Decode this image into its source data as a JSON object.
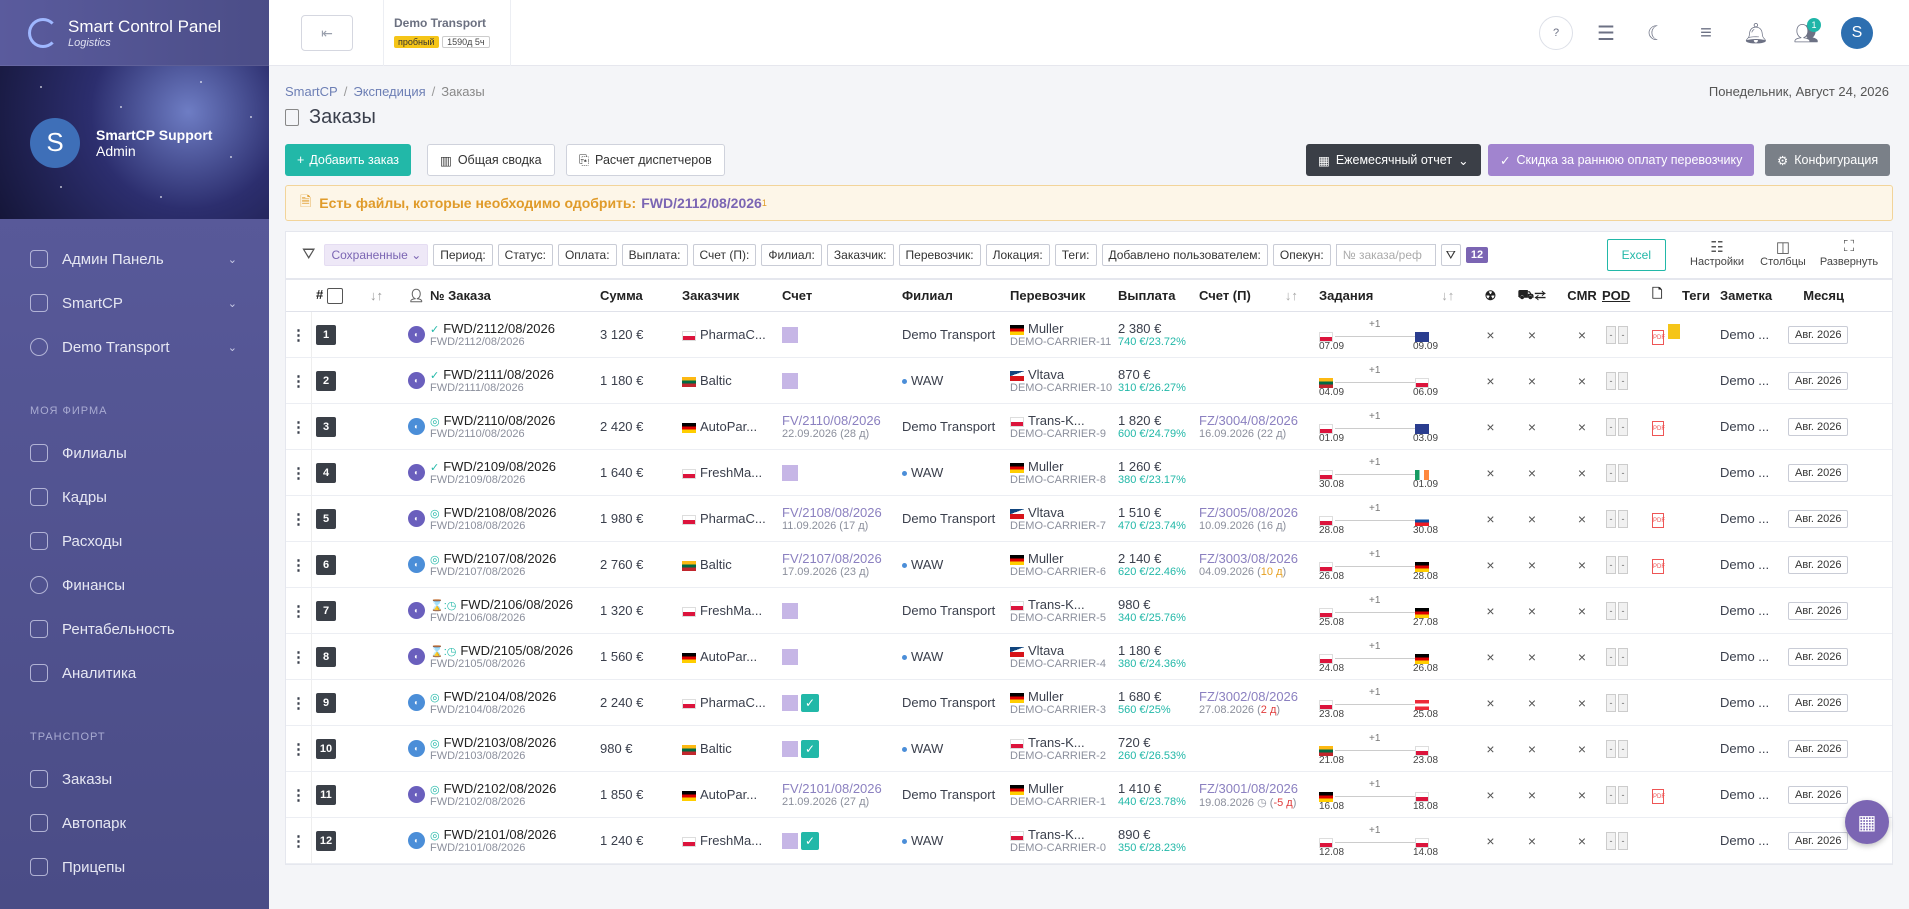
{
  "app": {
    "title": "Smart Control Panel",
    "subtitle": "Logistics"
  },
  "profile": {
    "name": "SmartCP Support",
    "role": "Admin",
    "initial": "S"
  },
  "sidebar": {
    "top": [
      {
        "label": "Админ Панель"
      },
      {
        "label": "SmartCP"
      },
      {
        "label": "Demo Transport"
      }
    ],
    "section1": "МОЯ ФИРМА",
    "firm": [
      {
        "label": "Филиалы"
      },
      {
        "label": "Кадры"
      },
      {
        "label": "Расходы"
      },
      {
        "label": "Финансы"
      },
      {
        "label": "Рентабельность"
      },
      {
        "label": "Аналитика"
      }
    ],
    "section2": "ТРАНСПОРТ",
    "transport": [
      {
        "label": "Заказы"
      },
      {
        "label": "Автопарк"
      },
      {
        "label": "Прицепы"
      }
    ]
  },
  "topbar": {
    "org_name": "Demo Transport",
    "badge_trial": "пробный",
    "badge_time": "1590д 5ч",
    "help": "?",
    "notif_count": "1",
    "user_initial": "S"
  },
  "breadcrumb": {
    "root": "SmartCP",
    "mid": "Экспедиция",
    "current": "Заказы"
  },
  "date": "Понедельник, Август 24, 2026",
  "page_title": "Заказы",
  "actions": {
    "add": "Добавить заказ",
    "summary": "Общая сводка",
    "dispatch": "Расчет диспетчеров",
    "monthly": "Ежемесячный отчет",
    "discount": "Скидка за раннюю оплату перевозчику",
    "config": "Конфигурация"
  },
  "alert": {
    "text": "Есть файлы, которые необходимо одобрить:",
    "link": "FWD/2112/08/2026",
    "sup": "1"
  },
  "filters": {
    "saved": "Сохраненные",
    "chips": [
      "Период:",
      "Статус:",
      "Оплата:",
      "Выплата:",
      "Счет (П):",
      "Филиал:",
      "Заказчик:",
      "Перевозчик:",
      "Локация:",
      "Теги:",
      "Добавлено пользователем:",
      "Опекун:"
    ],
    "search_placeholder": "№ заказа/реф",
    "count": "12",
    "excel": "Excel",
    "tools": [
      "Настройки",
      "Столбцы",
      "Развернуть"
    ]
  },
  "columns": {
    "num": "#",
    "order": "№ Заказа",
    "sum": "Сумма",
    "customer": "Заказчик",
    "invoice": "Счет",
    "branch": "Филиал",
    "carrier": "Перевозчик",
    "payout": "Выплата",
    "inv_p": "Счет (П)",
    "tasks": "Задания",
    "cmr": "CMR",
    "pod": "POD",
    "tags": "Теги",
    "note": "Заметка",
    "month": "Месяц"
  },
  "rows": [
    {
      "n": "1",
      "status": "✓",
      "order": "FWD/2112/08/2026",
      "sub": "FWD/2112/08/2026",
      "sum": "3 120 €",
      "cust_flag": "pl",
      "cust": "PharmaC...",
      "inv": "",
      "inv_date": "",
      "inv_sq": true,
      "inv_chk": false,
      "branch": "Demo Transport",
      "branch_dot": false,
      "car_flag": "de",
      "carrier": "Muller",
      "car_sub": "DEMO-CARRIER-11",
      "pay": "2 380 €",
      "pay_sub": "740 €/23.72%",
      "ip": "",
      "ip_date": "",
      "ip_extra": "",
      "t_from": "pl",
      "d_from": "07.09",
      "t_to": "gb",
      "d_to": "09.09",
      "pdf": true,
      "file": true,
      "note": "Demo ...",
      "month": "Авг. 2026",
      "circ": "a"
    },
    {
      "n": "2",
      "status": "✓",
      "order": "FWD/2111/08/2026",
      "sub": "FWD/2111/08/2026",
      "sum": "1 180 €",
      "cust_flag": "lt",
      "cust": "Baltic",
      "inv": "",
      "inv_date": "",
      "inv_sq": true,
      "inv_chk": false,
      "branch": "WAW",
      "branch_dot": true,
      "car_flag": "cz",
      "carrier": "Vltava",
      "car_sub": "DEMO-CARRIER-10",
      "pay": "870 €",
      "pay_sub": "310 €/26.27%",
      "ip": "",
      "ip_date": "",
      "ip_extra": "",
      "t_from": "lt",
      "d_from": "04.09",
      "t_to": "pl",
      "d_to": "06.09",
      "pdf": false,
      "file": false,
      "note": "Demo ...",
      "month": "Авг. 2026",
      "circ": "a"
    },
    {
      "n": "3",
      "status": "◎",
      "order": "FWD/2110/08/2026",
      "sub": "FWD/2110/08/2026",
      "sum": "2 420 €",
      "cust_flag": "de",
      "cust": "AutoPar...",
      "inv": "FV/2110/08/2026",
      "inv_date": "22.09.2026 (28 д)",
      "inv_sq": false,
      "inv_chk": false,
      "branch": "Demo Transport",
      "branch_dot": false,
      "car_flag": "pl",
      "carrier": "Trans-K...",
      "car_sub": "DEMO-CARRIER-9",
      "pay": "1 820 €",
      "pay_sub": "600 €/24.79%",
      "ip": "FZ/3004/08/2026",
      "ip_date": "16.09.2026 (22 д)",
      "ip_extra": "",
      "t_from": "pl",
      "d_from": "01.09",
      "t_to": "gb",
      "d_to": "03.09",
      "pdf": true,
      "file": false,
      "note": "Demo ...",
      "month": "Авг. 2026",
      "circ": "b"
    },
    {
      "n": "4",
      "status": "✓",
      "order": "FWD/2109/08/2026",
      "sub": "FWD/2109/08/2026",
      "sum": "1 640 €",
      "cust_flag": "pl",
      "cust": "FreshMa...",
      "inv": "",
      "inv_date": "",
      "inv_sq": true,
      "inv_chk": false,
      "branch": "WAW",
      "branch_dot": true,
      "car_flag": "de",
      "carrier": "Muller",
      "car_sub": "DEMO-CARRIER-8",
      "pay": "1 260 €",
      "pay_sub": "380 €/23.17%",
      "ip": "",
      "ip_date": "",
      "ip_extra": "",
      "t_from": "pl",
      "d_from": "30.08",
      "t_to": "ie",
      "d_to": "01.09",
      "pdf": false,
      "file": false,
      "note": "Demo ...",
      "month": "Авг. 2026",
      "circ": "a"
    },
    {
      "n": "5",
      "status": "◎",
      "order": "FWD/2108/08/2026",
      "sub": "FWD/2108/08/2026",
      "sum": "1 980 €",
      "cust_flag": "pl",
      "cust": "PharmaC...",
      "inv": "FV/2108/08/2026",
      "inv_date": "11.09.2026 (17 д)",
      "inv_sq": false,
      "inv_chk": false,
      "branch": "Demo Transport",
      "branch_dot": false,
      "car_flag": "cz",
      "carrier": "Vltava",
      "car_sub": "DEMO-CARRIER-7",
      "pay": "1 510 €",
      "pay_sub": "470 €/23.74%",
      "ip": "FZ/3005/08/2026",
      "ip_date": "10.09.2026 (16 д)",
      "ip_extra": "",
      "t_from": "pl",
      "d_from": "28.08",
      "t_to": "sk",
      "d_to": "30.08",
      "pdf": true,
      "file": false,
      "note": "Demo ...",
      "month": "Авг. 2026",
      "circ": "a"
    },
    {
      "n": "6",
      "status": "◎",
      "order": "FWD/2107/08/2026",
      "sub": "FWD/2107/08/2026",
      "sum": "2 760 €",
      "cust_flag": "lt",
      "cust": "Baltic",
      "inv": "FV/2107/08/2026",
      "inv_date": "17.09.2026 (23 д)",
      "inv_sq": false,
      "inv_chk": false,
      "branch": "WAW",
      "branch_dot": true,
      "car_flag": "de",
      "carrier": "Muller",
      "car_sub": "DEMO-CARRIER-6",
      "pay": "2 140 €",
      "pay_sub": "620 €/22.46%",
      "ip": "FZ/3003/08/2026",
      "ip_date": "04.09.2026 (",
      "ip_extra": "10 д",
      "t_from": "pl",
      "d_from": "26.08",
      "t_to": "de",
      "d_to": "28.08",
      "pdf": true,
      "file": false,
      "note": "Demo ...",
      "month": "Авг. 2026",
      "circ": "b"
    },
    {
      "n": "7",
      "status": "⌛:◷",
      "order": "FWD/2106/08/2026",
      "sub": "FWD/2106/08/2026",
      "sum": "1 320 €",
      "cust_flag": "pl",
      "cust": "FreshMa...",
      "inv": "",
      "inv_date": "",
      "inv_sq": true,
      "inv_chk": false,
      "branch": "Demo Transport",
      "branch_dot": false,
      "car_flag": "pl",
      "carrier": "Trans-K...",
      "car_sub": "DEMO-CARRIER-5",
      "pay": "980 €",
      "pay_sub": "340 €/25.76%",
      "ip": "",
      "ip_date": "",
      "ip_extra": "",
      "t_from": "pl",
      "d_from": "25.08",
      "t_to": "de",
      "d_to": "27.08",
      "pdf": false,
      "file": false,
      "note": "Demo ...",
      "month": "Авг. 2026",
      "circ": "a"
    },
    {
      "n": "8",
      "status": "⌛:◷",
      "order": "FWD/2105/08/2026",
      "sub": "FWD/2105/08/2026",
      "sum": "1 560 €",
      "cust_flag": "de",
      "cust": "AutoPar...",
      "inv": "",
      "inv_date": "",
      "inv_sq": true,
      "inv_chk": false,
      "branch": "WAW",
      "branch_dot": true,
      "car_flag": "cz",
      "carrier": "Vltava",
      "car_sub": "DEMO-CARRIER-4",
      "pay": "1 180 €",
      "pay_sub": "380 €/24.36%",
      "ip": "",
      "ip_date": "",
      "ip_extra": "",
      "t_from": "pl",
      "d_from": "24.08",
      "t_to": "de",
      "d_to": "26.08",
      "pdf": false,
      "file": false,
      "note": "Demo ...",
      "month": "Авг. 2026",
      "circ": "a"
    },
    {
      "n": "9",
      "status": "◎",
      "order": "FWD/2104/08/2026",
      "sub": "FWD/2104/08/2026",
      "sum": "2 240 €",
      "cust_flag": "pl",
      "cust": "PharmaC...",
      "inv": "",
      "inv_date": "",
      "inv_sq": true,
      "inv_chk": true,
      "branch": "Demo Transport",
      "branch_dot": false,
      "car_flag": "de",
      "carrier": "Muller",
      "car_sub": "DEMO-CARRIER-3",
      "pay": "1 680 €",
      "pay_sub": "560 €/25%",
      "ip": "FZ/3002/08/2026",
      "ip_date": "27.08.2026 (",
      "ip_extra": "2 д",
      "t_from": "pl",
      "d_from": "23.08",
      "t_to": "at",
      "d_to": "25.08",
      "pdf": false,
      "file": false,
      "note": "Demo ...",
      "month": "Авг. 2026",
      "circ": "b"
    },
    {
      "n": "10",
      "status": "◎",
      "order": "FWD/2103/08/2026",
      "sub": "FWD/2103/08/2026",
      "sum": "980 €",
      "cust_flag": "lt",
      "cust": "Baltic",
      "inv": "",
      "inv_date": "",
      "inv_sq": true,
      "inv_chk": true,
      "branch": "WAW",
      "branch_dot": true,
      "car_flag": "pl",
      "carrier": "Trans-K...",
      "car_sub": "DEMO-CARRIER-2",
      "pay": "720 €",
      "pay_sub": "260 €/26.53%",
      "ip": "",
      "ip_date": "",
      "ip_extra": "",
      "t_from": "lt",
      "d_from": "21.08",
      "t_to": "pl",
      "d_to": "23.08",
      "pdf": false,
      "file": false,
      "note": "Demo ...",
      "month": "Авг. 2026",
      "circ": "b"
    },
    {
      "n": "11",
      "status": "◎",
      "order": "FWD/2102/08/2026",
      "sub": "FWD/2102/08/2026",
      "sum": "1 850 €",
      "cust_flag": "de",
      "cust": "AutoPar...",
      "inv": "FV/2101/08/2026",
      "inv_date": "21.09.2026 (27 д)",
      "inv_sq": false,
      "inv_chk": false,
      "branch": "Demo Transport",
      "branch_dot": false,
      "car_flag": "de",
      "carrier": "Muller",
      "car_sub": "DEMO-CARRIER-1",
      "pay": "1 410 €",
      "pay_sub": "440 €/23.78%",
      "ip": "FZ/3001/08/2026",
      "ip_date": "19.08.2026 ◷ (",
      "ip_extra": "-5 д",
      "t_from": "de",
      "d_from": "16.08",
      "t_to": "pl",
      "d_to": "18.08",
      "pdf": true,
      "file": false,
      "note": "Demo ...",
      "month": "Авг. 2026",
      "circ": "a"
    },
    {
      "n": "12",
      "status": "◎",
      "order": "FWD/2101/08/2026",
      "sub": "FWD/2101/08/2026",
      "sum": "1 240 €",
      "cust_flag": "pl",
      "cust": "FreshMa...",
      "inv": "",
      "inv_date": "",
      "inv_sq": true,
      "inv_chk": true,
      "branch": "WAW",
      "branch_dot": true,
      "car_flag": "pl",
      "carrier": "Trans-K...",
      "car_sub": "DEMO-CARRIER-0",
      "pay": "890 €",
      "pay_sub": "350 €/28.23%",
      "ip": "",
      "ip_date": "",
      "ip_extra": "",
      "t_from": "pl",
      "d_from": "12.08",
      "t_to": "pl",
      "d_to": "14.08",
      "pdf": false,
      "file": false,
      "note": "Demo ...",
      "month": "Авг. 2026",
      "circ": "b"
    }
  ],
  "tasks_plus": "+1",
  "colors": {
    "accent": "#22b8a8",
    "purple": "#7b65b3",
    "sidebar": "#5c5d9f"
  }
}
